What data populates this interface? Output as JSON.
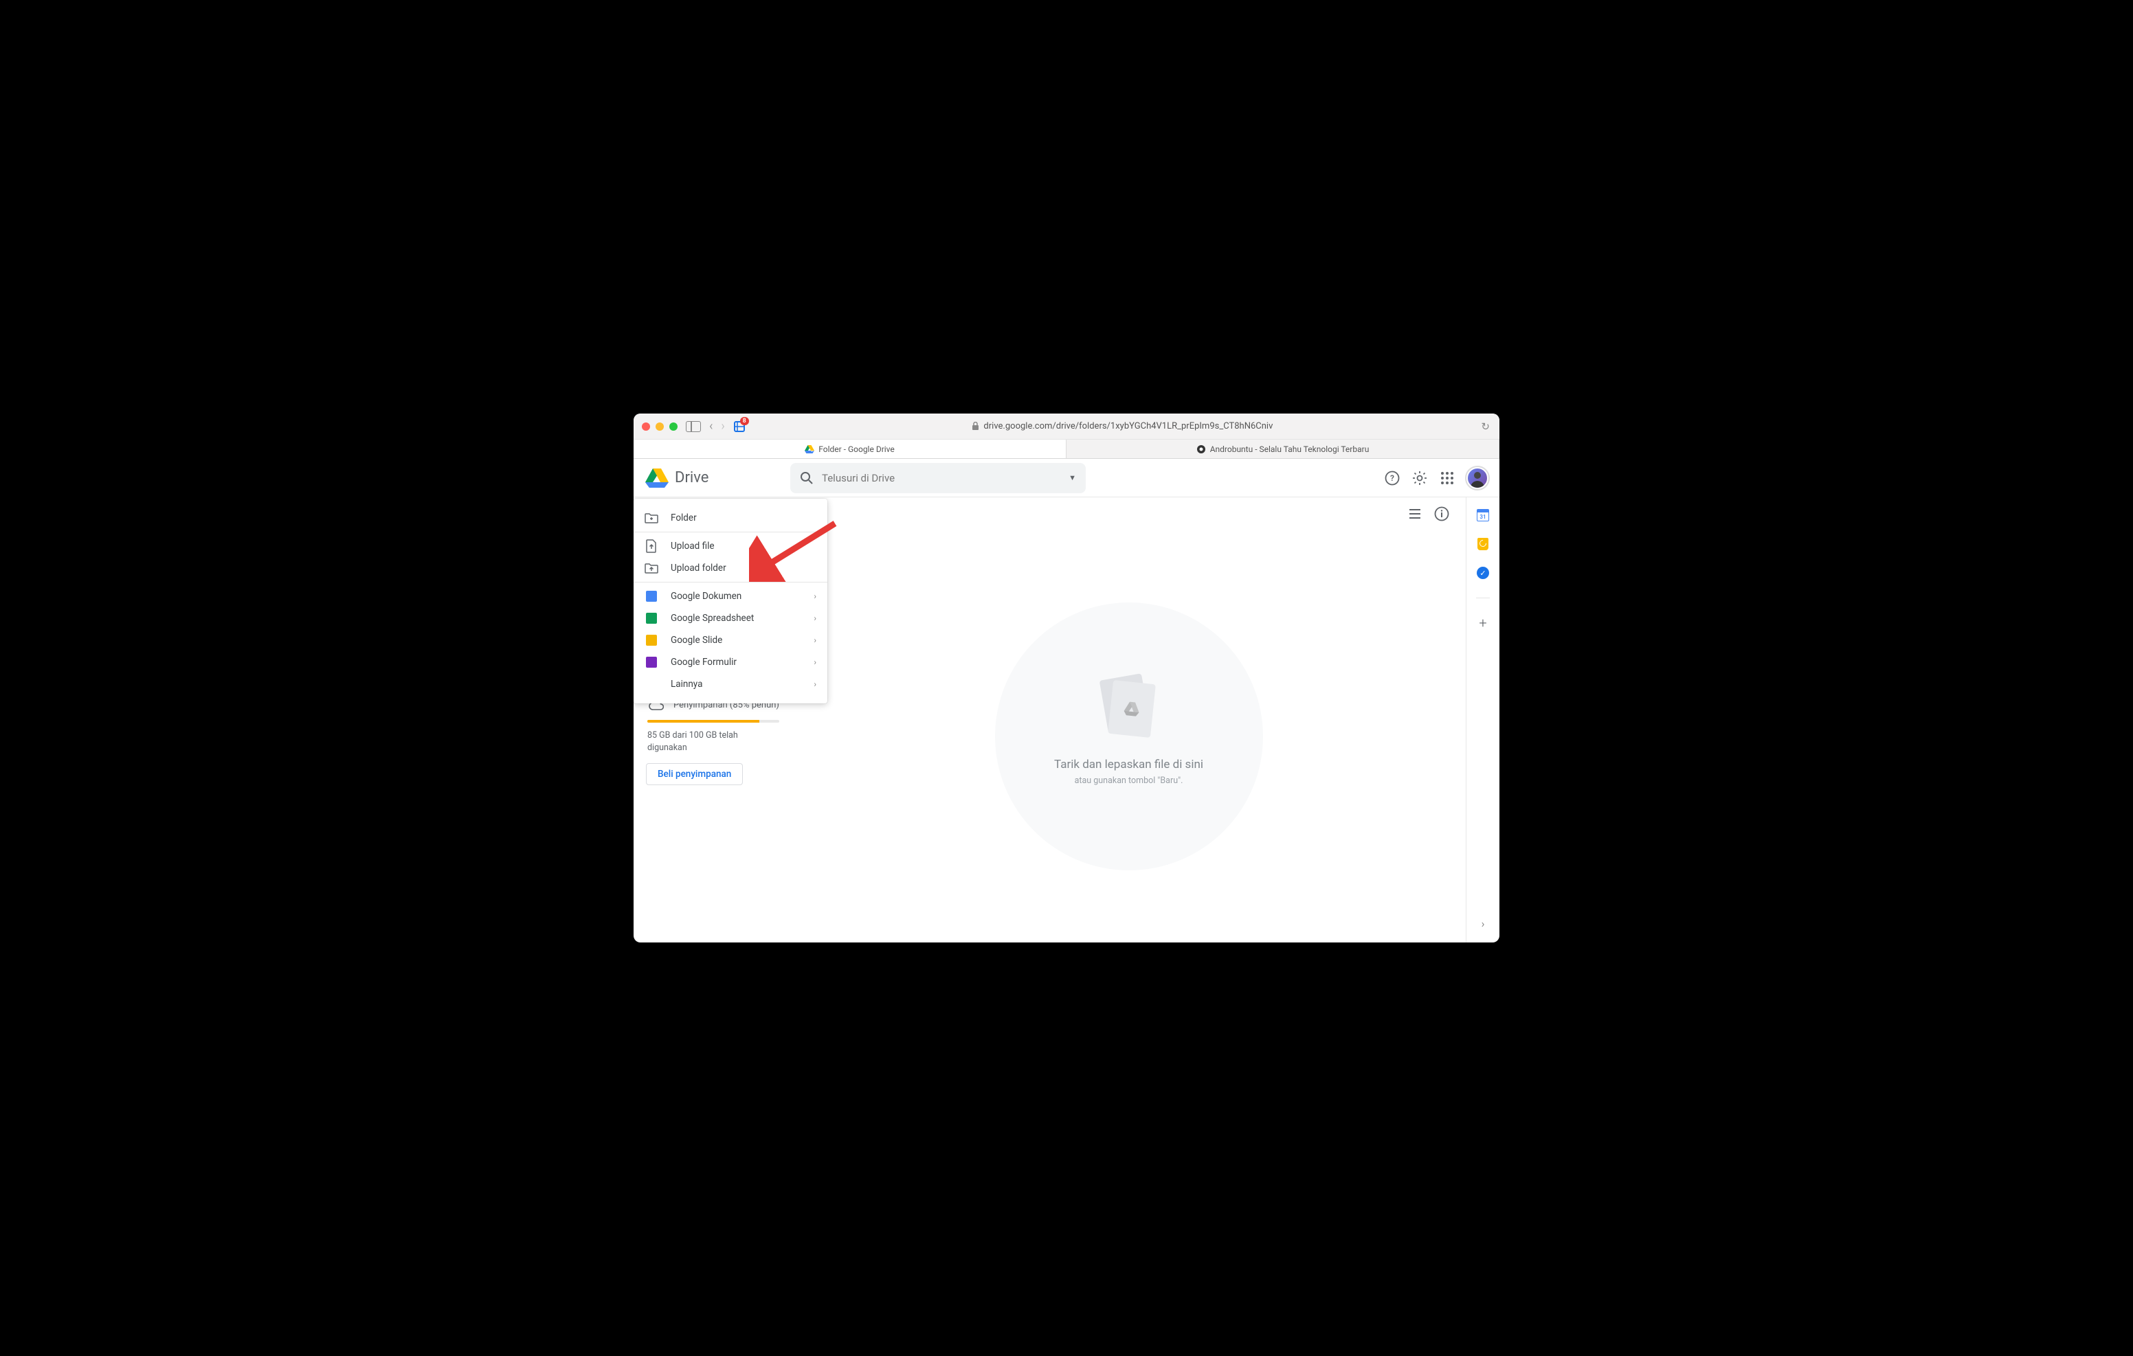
{
  "browser": {
    "url": "drive.google.com/drive/folders/1xybYGCh4V1LR_prEpIm9s_CT8hN6Cniv",
    "ext_badge": "8",
    "tabs": [
      {
        "title": "Folder - Google Drive",
        "active": true
      },
      {
        "title": "Androbuntu - Selalu Tahu Teknologi Terbaru",
        "active": false
      }
    ]
  },
  "header": {
    "product": "Drive",
    "search_placeholder": "Telusuri di Drive"
  },
  "context_menu": {
    "folder": "Folder",
    "upload_file": "Upload file",
    "upload_folder": "Upload folder",
    "docs": "Google Dokumen",
    "sheets": "Google Spreadsheet",
    "slides": "Google Slide",
    "forms": "Google Formulir",
    "more": "Lainnya"
  },
  "storage": {
    "label": "Penyimpanan (85% penuh)",
    "usage": "85 GB dari 100 GB telah digunakan",
    "buy": "Beli penyimpanan",
    "percent": 85
  },
  "empty": {
    "title": "Tarik dan lepaskan file di sini",
    "subtitle": "atau gunakan tombol \"Baru\"."
  }
}
